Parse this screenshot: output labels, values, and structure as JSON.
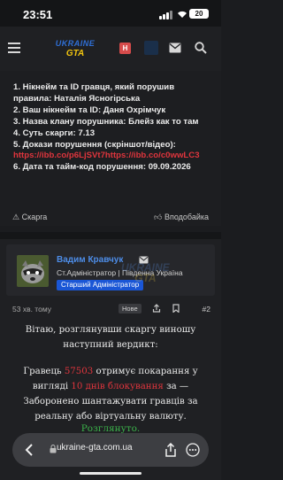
{
  "status_bar": {
    "time": "23:51",
    "battery": "20"
  },
  "header": {
    "logo_line1": "UKRAINE",
    "logo_line2": "GTA",
    "notification_letter": "H"
  },
  "complaint": {
    "line1": "1. Нікнейм та ID гравця, який порушив правила: Наталія Ясногірська",
    "line2": "2. Ваш нікнейм та ID: Даня Охрімчук",
    "line3": "3. Назва клану порушника: Блейз как то там",
    "line4": "4. Суть скарги: 7.13",
    "line5_label": "5. Докази порушення (скріншот/відео):",
    "line5_links": "https://ibb.co/p6LjSVt7https://ibb.co/c0wwLC3",
    "line6": "6. Дата та тайм-код порушення: 09.09.2026",
    "report_label": "Скарга",
    "like_label": "Вподобайка"
  },
  "post": {
    "author_name": "Вадим Кравчук",
    "author_role": "Ст.Адміністратор | Південна Україна",
    "author_badge": "Старший Адміністратор",
    "watermark_line1": "UKRAINE",
    "watermark_line2": "GTA",
    "time_ago": "53 хв. тому",
    "new_badge": "Нове",
    "post_number": "#2",
    "verdict_intro": "Вітаю, розглянувши скаргу виношу наступний вердикт:",
    "verdict_part1": "Гравець ",
    "verdict_id": "57503",
    "verdict_part2": " отримує покарання у вигляді ",
    "verdict_penalty": "10 днів блокування",
    "verdict_part3": " за — Заборонено шантажувати гравців за реальну або віртуальну валюту.",
    "verdict_sign": "Розглянуто."
  },
  "browser": {
    "url": "ukraine-gta.com.ua"
  },
  "colors": {
    "accent_red": "#e0353d",
    "author_blue": "#4d8de8",
    "badge_blue": "#1a56d6",
    "approved_green": "#3bb24a"
  }
}
